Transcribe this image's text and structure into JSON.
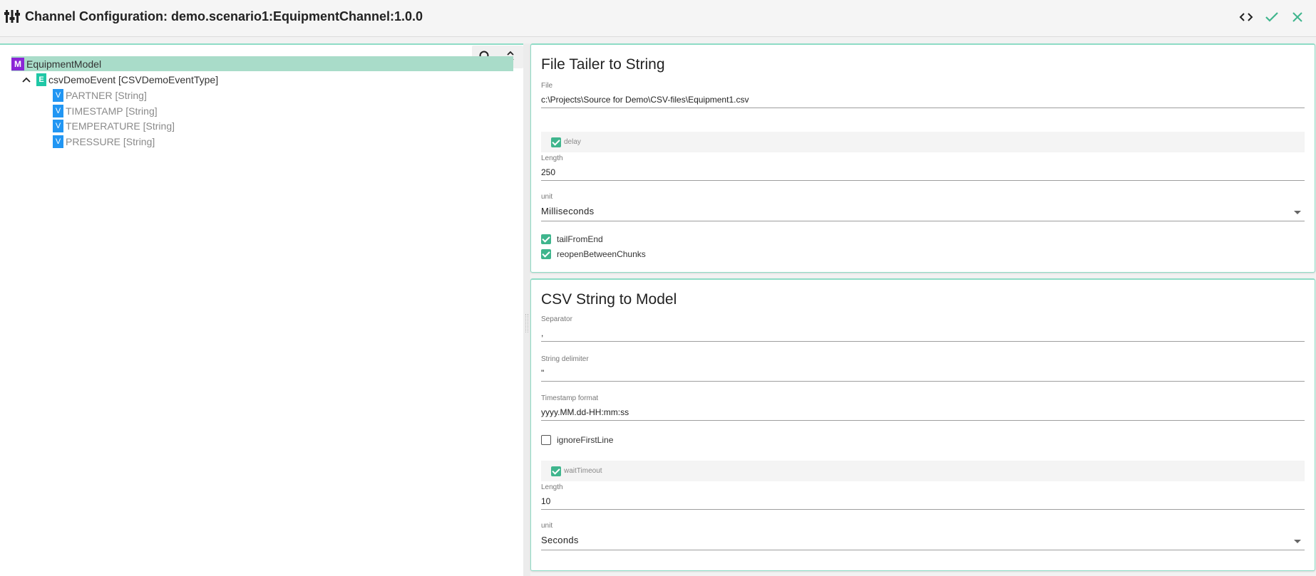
{
  "window": {
    "title": "Channel Configuration: demo.scenario1:EquipmentChannel:1.0.0",
    "actions": {
      "code": "code-icon",
      "apply": "check-icon",
      "close": "close-icon"
    }
  },
  "tree": {
    "model": {
      "badge": "M",
      "label": "EquipmentModel"
    },
    "event": {
      "badge": "E",
      "label": "csvDemoEvent [CSVDemoEventType]"
    },
    "variables": [
      {
        "badge": "V",
        "label": "PARTNER [String]"
      },
      {
        "badge": "V",
        "label": "TIMESTAMP [String]"
      },
      {
        "badge": "V",
        "label": "TEMPERATURE [String]"
      },
      {
        "badge": "V",
        "label": "PRESSURE [String]"
      }
    ]
  },
  "file_tailer": {
    "title": "File Tailer to String",
    "file_label": "File",
    "file_value": "c:\\Projects\\Source for Demo\\CSV-files\\Equipment1.csv",
    "delay_label": "delay",
    "length_label": "Length",
    "length_value": "250",
    "unit_label": "unit",
    "unit_value": "Milliseconds",
    "tail_from_end_label": "tailFromEnd",
    "reopen_label": "reopenBetweenChunks"
  },
  "csv_model": {
    "title": "CSV String to Model",
    "separator_label": "Separator",
    "separator_value": ",",
    "delimiter_label": "String delimiter",
    "delimiter_value": "\"",
    "timestamp_label": "Timestamp format",
    "timestamp_value": "yyyy.MM.dd-HH:mm:ss",
    "ignore_first_label": "ignoreFirstLine",
    "wait_timeout_label": "waitTimeout",
    "length_label": "Length",
    "length_value": "10",
    "unit_label": "unit",
    "unit_value": "Seconds"
  },
  "colors": {
    "accent": "#3fb58d",
    "model_badge": "#8b25d6",
    "event_badge": "#1fc7a6",
    "var_badge": "#2196f3",
    "selected_row": "#a9dcc9"
  }
}
